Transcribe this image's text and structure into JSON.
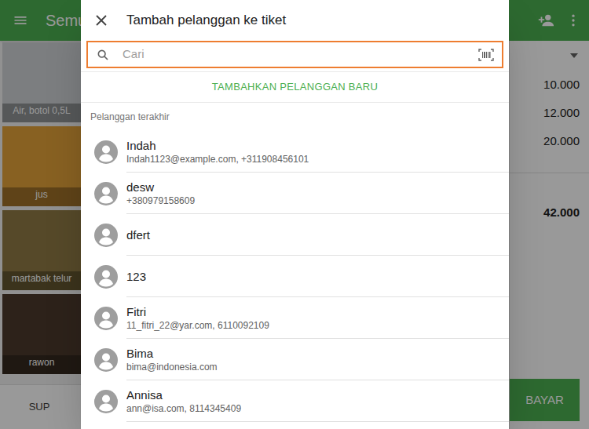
{
  "app": {
    "title": "Semu"
  },
  "products": [
    {
      "name": "Air, botol 0,5L"
    },
    {
      "name": "jus"
    },
    {
      "name": "martabak telur"
    },
    {
      "name": "rawon"
    }
  ],
  "categories": [
    {
      "label": "SUP"
    }
  ],
  "ticket": {
    "lines": [
      {
        "amount": "10.000"
      },
      {
        "amount": "12.000"
      },
      {
        "amount": "20.000"
      }
    ],
    "total": "42.000",
    "pay_button": "BAYAR"
  },
  "dialog": {
    "title": "Tambah pelanggan ke tiket",
    "search": {
      "placeholder": "Cari",
      "highlighted": true
    },
    "add_customer": "TAMBAHKAN PELANGGAN BARU",
    "section_title": "Pelanggan terakhir",
    "customers": [
      {
        "name": "Indah",
        "details": "Indah1123@example.com, +311908456101"
      },
      {
        "name": "desw",
        "details": "+380979158609"
      },
      {
        "name": "dfert"
      },
      {
        "name": "123"
      },
      {
        "name": "Fitri",
        "details": "11_fitri_22@yar.com, 6110092109"
      },
      {
        "name": "Bima",
        "details": "bima@indonesia.com"
      },
      {
        "name": "Annisa",
        "details": "ann@isa.com, 8114345409"
      }
    ]
  }
}
